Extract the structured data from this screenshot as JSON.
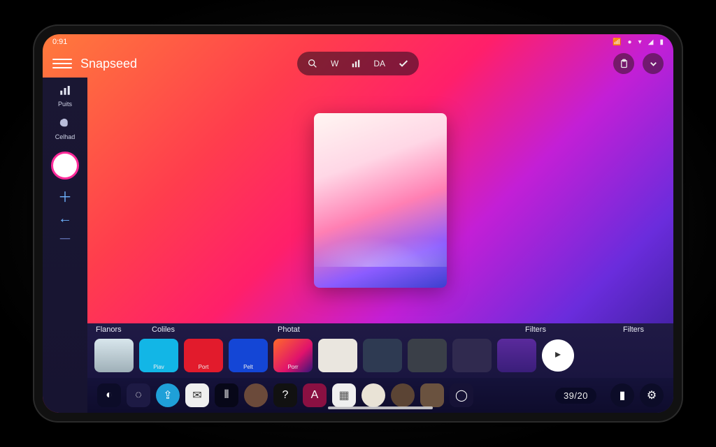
{
  "status": {
    "time": "0:91",
    "wifi_icon": "wifi",
    "right_icons": [
      "●",
      "▾",
      "◢",
      "▮"
    ]
  },
  "header": {
    "title": "Snapseed",
    "pill": [
      "search",
      "W",
      "chart",
      "DA",
      "check"
    ],
    "right": [
      "clipboard",
      "chevron"
    ]
  },
  "sidebar": {
    "items": [
      {
        "icon": "bars",
        "label": "Puits"
      },
      {
        "icon": "blob",
        "label": "Celhad"
      }
    ],
    "tools": [
      "plus",
      "back",
      "minus"
    ]
  },
  "strip": {
    "labels": [
      "Flanors",
      "Coliles",
      "Photat",
      "Filters",
      "Filters"
    ],
    "thumbs": [
      {
        "label": "",
        "bg": "linear-gradient(#d8e6ec,#9fb0b8)"
      },
      {
        "label": "Piav",
        "bg": "#12b6e6"
      },
      {
        "label": "Port",
        "bg": "#e21b2c"
      },
      {
        "label": "Pelt",
        "bg": "#1446d6"
      },
      {
        "label": "Porr",
        "bg": "linear-gradient(135deg,#ff6a2a,#e0126c 60%,#36157a)"
      },
      {
        "label": "",
        "bg": "#eae6df"
      },
      {
        "label": "",
        "bg": "#2e3a52"
      },
      {
        "label": "",
        "bg": "#3a3f48"
      },
      {
        "label": "",
        "bg": "#302a4f"
      },
      {
        "label": "",
        "bg": "linear-gradient(#5a2a9c,#3a1e7a)"
      },
      {
        "label": "▸",
        "bg": "#fff",
        "round": true
      }
    ]
  },
  "dock": {
    "left": [
      {
        "name": "moon",
        "bg": "#0c0c28",
        "glyph": "◐"
      },
      {
        "name": "target",
        "bg": "#1d1a44",
        "glyph": "◌"
      },
      {
        "name": "share",
        "bg": "#1fa0d8",
        "glyph": "⇪",
        "round": true
      },
      {
        "name": "mail",
        "bg": "#efefef",
        "glyph": "✉",
        "fg": "#333"
      },
      {
        "name": "levels",
        "bg": "#070718",
        "glyph": "⦀"
      },
      {
        "name": "avatar1",
        "bg": "#6b4a3a",
        "glyph": "",
        "round": true
      },
      {
        "name": "help",
        "bg": "#111",
        "glyph": "?"
      },
      {
        "name": "app",
        "bg": "#8a1042",
        "glyph": "A"
      },
      {
        "name": "grid",
        "bg": "#efefef",
        "glyph": "▦",
        "fg": "#555"
      },
      {
        "name": "avatar2",
        "bg": "#e9e3d6",
        "glyph": "",
        "round": true
      },
      {
        "name": "avatar3",
        "bg": "#5b4434",
        "glyph": "",
        "round": true
      },
      {
        "name": "thumb",
        "bg": "#6a523f",
        "glyph": ""
      },
      {
        "name": "ring",
        "bg": "#161236",
        "glyph": "◯"
      }
    ],
    "counter": "39/20",
    "right": [
      {
        "name": "pause",
        "bg": "#0c0c28",
        "glyph": "▮",
        "round": true
      },
      {
        "name": "gear",
        "bg": "#0c0c28",
        "glyph": "⚙",
        "round": true
      }
    ]
  }
}
